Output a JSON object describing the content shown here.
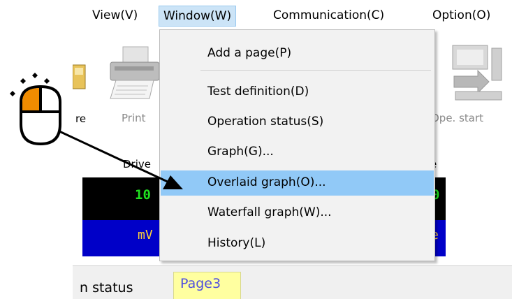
{
  "menubar": {
    "items": [
      "View(V)",
      "Window(W)",
      "Communication(C)",
      "Option(O)"
    ]
  },
  "toolbar": {
    "save_label": "re",
    "print_label": "Print",
    "ope_start_label": "Ope. start"
  },
  "status_panel": {
    "left_header": "Drive",
    "right_header": "e",
    "left_value": "10",
    "right_value": "0",
    "left_unit": "mV",
    "right_unit": "e"
  },
  "tabs": {
    "op_status": "n status",
    "page3": "Page3"
  },
  "dropdown": {
    "items": [
      "Add a page(P)",
      "Test definition(D)",
      "Operation status(S)",
      "Graph(G)...",
      "Overlaid graph(O)...",
      "Waterfall graph(W)...",
      "History(L)"
    ],
    "highlighted": "Overlaid graph(O)..."
  },
  "colors": {
    "menu_highlight": "#cce4f7",
    "item_highlight": "#91c9f7",
    "mouse_button": "#f08c00",
    "panel_value": "#20e020",
    "panel_unit": "#ffd23a",
    "panel_blue": "#0000c8",
    "tab_page3_bg": "#ffffa0"
  },
  "icons": [
    "save-icon",
    "printer-icon",
    "ope-start-icon",
    "mouse-click-icon",
    "pointer-arrow-icon"
  ]
}
